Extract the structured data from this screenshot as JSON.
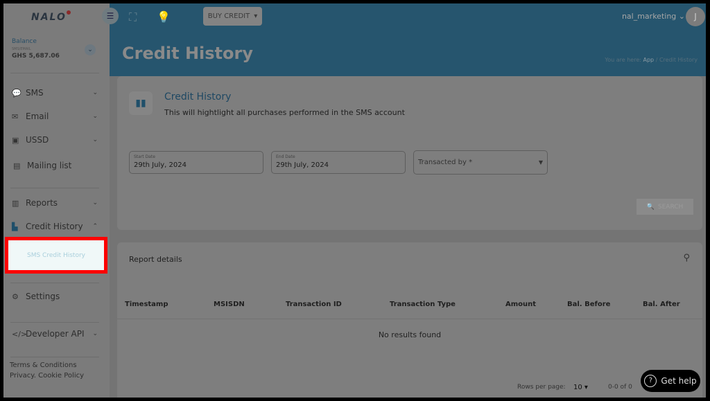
{
  "brand": {
    "logo": "NALO"
  },
  "sidebar": {
    "balance": {
      "label": "Balance",
      "sub": "SMS/EMAIL",
      "amount": "GHS 5,687.06"
    },
    "items": [
      {
        "label": "SMS",
        "icon": "chat-icon"
      },
      {
        "label": "Email",
        "icon": "mail-icon"
      },
      {
        "label": "USSD",
        "icon": "ussd-icon"
      },
      {
        "label": "Mailing list",
        "icon": "list-icon"
      },
      {
        "label": "Reports",
        "icon": "report-icon"
      },
      {
        "label": "Credit History",
        "icon": "document-icon"
      },
      {
        "label": "Settings",
        "icon": "gear-icon"
      },
      {
        "label": "Developer API",
        "icon": "code-icon"
      }
    ],
    "highlighted_subitem": "SMS Credit History",
    "footer": {
      "terms": "Terms & Conditions",
      "privacy": "Privacy. Cookie Policy"
    }
  },
  "topbar": {
    "buy_credit": "BUY CREDIT",
    "username": "nal_marketing",
    "avatar_initial": "J"
  },
  "header": {
    "title": "Credit History",
    "breadcrumb": {
      "prefix": "You are here:",
      "app": "App",
      "sep": "/",
      "current": "Credit History"
    }
  },
  "filter_card": {
    "title": "Credit History",
    "description": "This will hightlight all purchases performed in the SMS account",
    "start_date": {
      "label": "Start Date",
      "value": "29th July, 2024"
    },
    "end_date": {
      "label": "End Date",
      "value": "29th July, 2024"
    },
    "transacted_by": {
      "placeholder": "Transacted by *"
    },
    "search_label": "SEARCH"
  },
  "report": {
    "title": "Report details",
    "columns": [
      "Timestamp",
      "MSISDN",
      "Transaction ID",
      "Transaction Type",
      "Amount",
      "Bal. Before",
      "Bal. After"
    ],
    "empty": "No results found",
    "rows_per_page_label": "Rows per page:",
    "rows_per_page": "10",
    "range": "0-0 of 0"
  },
  "help": {
    "label": "Get help"
  },
  "colors": {
    "highlight_border": "#ff0000",
    "header_blue": "#26556e"
  }
}
